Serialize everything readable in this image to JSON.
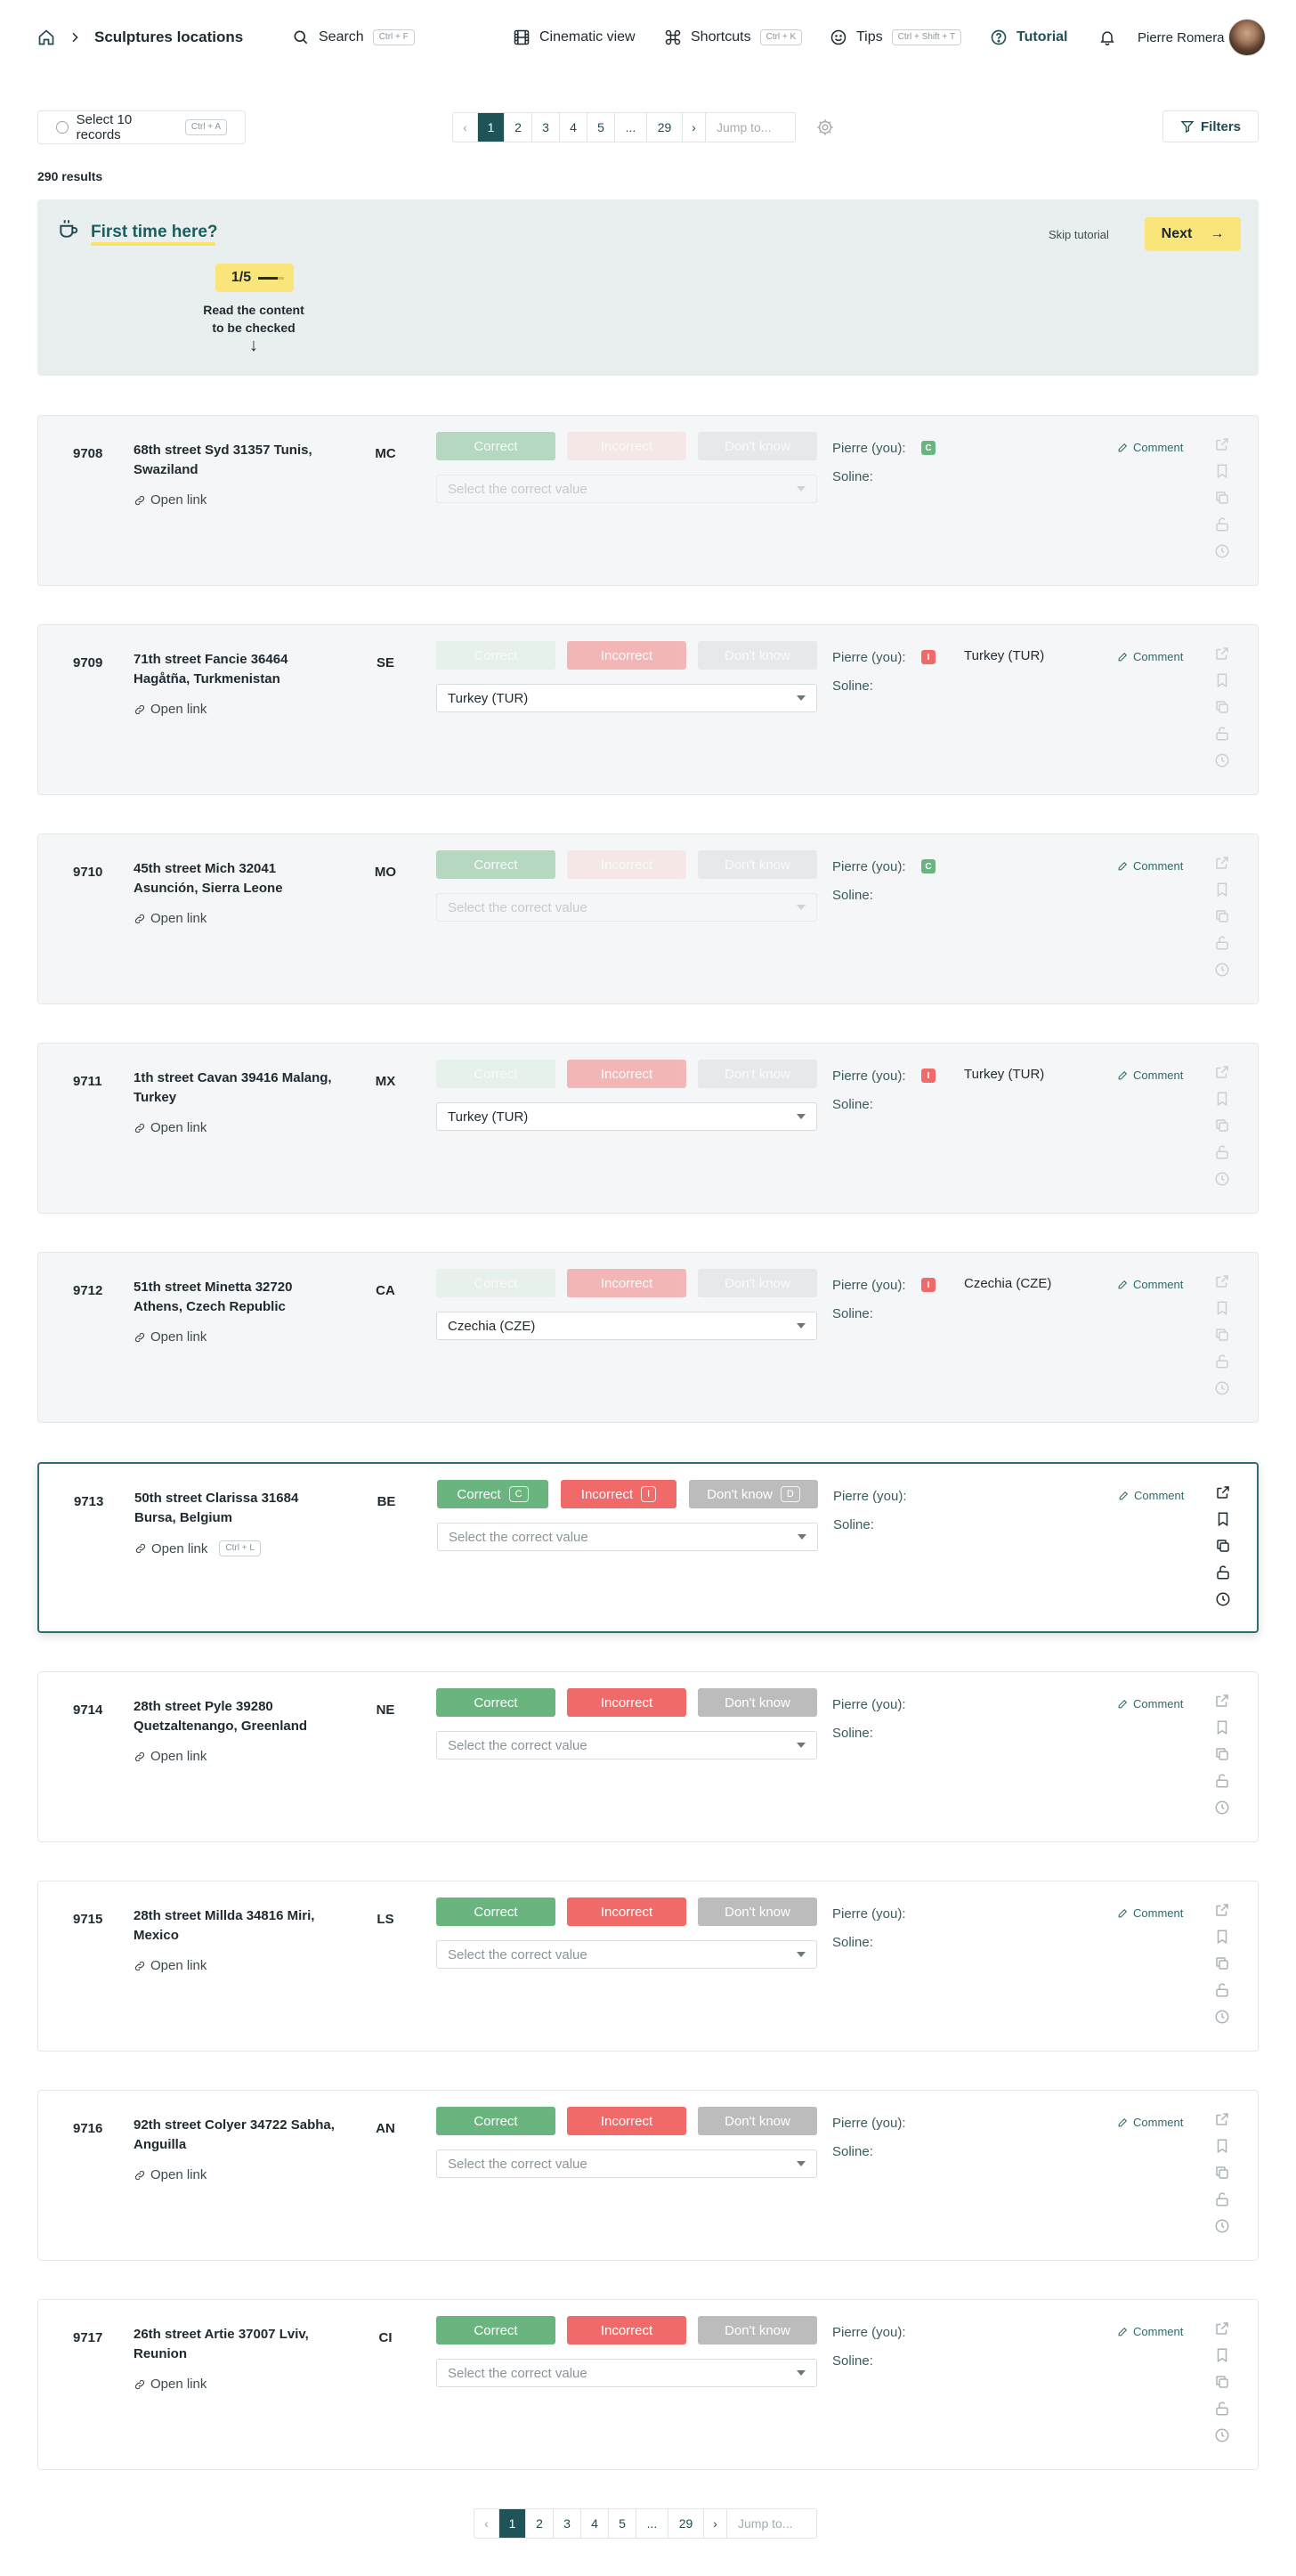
{
  "header": {
    "title": "Sculptures locations",
    "search": "Search",
    "search_kbd": "Ctrl + F",
    "cinematic": "Cinematic view",
    "shortcuts": "Shortcuts",
    "shortcuts_kbd": "Ctrl + K",
    "tips": "Tips",
    "tips_kbd": "Ctrl + Shift + T",
    "tutorial": "Tutorial",
    "user": "Pierre Romera"
  },
  "toolbar": {
    "select_label": "Select 10 records",
    "select_kbd": "Ctrl + A",
    "pages": [
      "1",
      "2",
      "3",
      "4",
      "5",
      "...",
      "29"
    ],
    "prev": "‹",
    "next": "›",
    "jump": "Jump to...",
    "filters": "Filters"
  },
  "results": "290 results",
  "tutorial": {
    "title": "First time here?",
    "skip": "Skip tutorial",
    "next": "Next",
    "next_icon": "→",
    "step": "1/5",
    "step_line1": "Read the content",
    "step_line2": "to be checked",
    "arrow": "↓"
  },
  "labels": {
    "correct": "Correct",
    "incorrect": "Incorrect",
    "dont_know": "Don't know",
    "placeholder": "Select the correct value",
    "open_link": "Open link",
    "comment": "Comment",
    "reviewer_1": "Pierre (you):",
    "reviewer_2": "Soline:",
    "kbd_correct": "C",
    "kbd_incorrect": "I",
    "kbd_dont_know": "D",
    "kbd_link": "Ctrl + L",
    "badge_correct": "C",
    "badge_incorrect": "I"
  },
  "records": [
    {
      "id": "9708",
      "addr": "68th street Syd 31357 Tunis, Swaziland",
      "code": "MC",
      "value": "",
      "verdict": "correct"
    },
    {
      "id": "9709",
      "addr": "71th street Fancie 36464 Hagåtña, Turkmenistan",
      "code": "SE",
      "value": "Turkey (TUR)",
      "verdict": "incorrect"
    },
    {
      "id": "9710",
      "addr": "45th street Mich 32041 Asunción, Sierra Leone",
      "code": "MO",
      "value": "",
      "verdict": "correct"
    },
    {
      "id": "9711",
      "addr": "1th street Cavan 39416 Malang, Turkey",
      "code": "MX",
      "value": "Turkey (TUR)",
      "verdict": "incorrect"
    },
    {
      "id": "9712",
      "addr": "51th street Minetta 32720 Athens, Czech Republic",
      "code": "CA",
      "value": "Czechia (CZE)",
      "verdict": "incorrect"
    },
    {
      "id": "9713",
      "addr": "50th street Clarissa 31684 Bursa, Belgium",
      "code": "BE",
      "value": "",
      "verdict": "none"
    },
    {
      "id": "9714",
      "addr": "28th street Pyle 39280 Quetzaltenango, Greenland",
      "code": "NE",
      "value": "",
      "verdict": "none"
    },
    {
      "id": "9715",
      "addr": "28th street Millda 34816 Miri, Mexico",
      "code": "LS",
      "value": "",
      "verdict": "none"
    },
    {
      "id": "9716",
      "addr": "92th street Colyer 34722 Sabha, Anguilla",
      "code": "AN",
      "value": "",
      "verdict": "none"
    },
    {
      "id": "9717",
      "addr": "26th street Artie 37007 Lviv, Reunion",
      "code": "CI",
      "value": "",
      "verdict": "none"
    }
  ],
  "colors": {
    "primary": "#1e5358",
    "correct": "#6ab47f",
    "incorrect": "#f06a6a",
    "dont_know": "#bcbcbc",
    "highlight": "#fae57a"
  },
  "icons": [
    "home-icon",
    "chevron-right-icon",
    "search-icon",
    "film-icon",
    "command-icon",
    "smiley-icon",
    "help-circle-icon",
    "bell-icon",
    "settings-icon",
    "filter-icon",
    "coffee-icon",
    "link-icon",
    "pencil-icon",
    "external-link-icon",
    "bookmark-icon",
    "copy-icon",
    "unlock-icon",
    "clock-icon"
  ]
}
